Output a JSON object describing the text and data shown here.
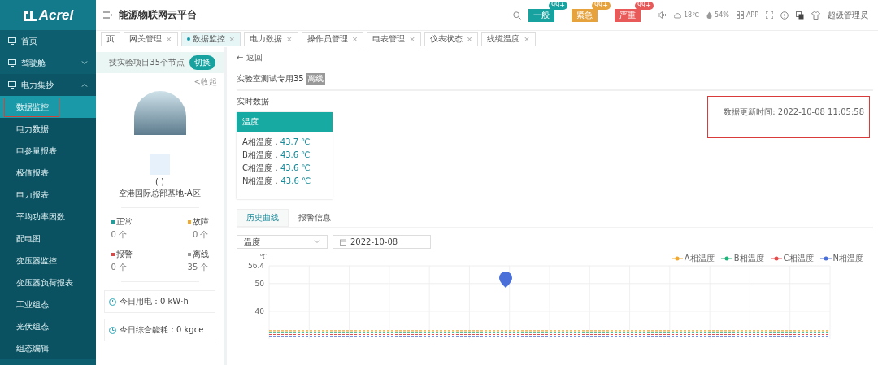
{
  "logo": {
    "text": "Acrel"
  },
  "header": {
    "title": "能源物联网云平台",
    "alarms": [
      {
        "label": "一般",
        "count": "99+",
        "color": "#17a2a0"
      },
      {
        "label": "紧急",
        "count": "99+",
        "color": "#e6a23c"
      },
      {
        "label": "严重",
        "count": "99+",
        "color": "#e8595a"
      }
    ],
    "temperature": "18℃",
    "humidity": "54%",
    "app": "APP",
    "user": "超级管理员"
  },
  "tabs": [
    {
      "label": "页",
      "selected": false
    },
    {
      "label": "网关管理",
      "selected": false,
      "close": "×"
    },
    {
      "label": "数据监控",
      "selected": true,
      "close": "×"
    },
    {
      "label": "电力数据",
      "selected": false,
      "close": "×"
    },
    {
      "label": "操作员管理",
      "selected": false,
      "close": "×"
    },
    {
      "label": "电表管理",
      "selected": false,
      "close": "×"
    },
    {
      "label": "仪表状态",
      "selected": false,
      "close": "×"
    },
    {
      "label": "线缆温度",
      "selected": false,
      "close": "×"
    }
  ],
  "sidebar": {
    "items": [
      {
        "label": "首页"
      },
      {
        "label": "驾驶舱",
        "expanded": false
      },
      {
        "label": "电力集抄",
        "expanded": true,
        "children": [
          {
            "label": "数据监控",
            "selected": true
          },
          {
            "label": "电力数据",
            "selected": false
          },
          {
            "label": "电参量报表",
            "selected": false
          },
          {
            "label": "极值报表",
            "selected": false
          },
          {
            "label": "电力报表",
            "selected": false
          },
          {
            "label": "平均功率因数",
            "selected": false
          },
          {
            "label": "配电图",
            "selected": false
          },
          {
            "label": "变压器监控",
            "selected": false
          },
          {
            "label": "变压器负荷报表",
            "selected": false
          },
          {
            "label": "工业组态",
            "selected": false
          },
          {
            "label": "光伏组态",
            "selected": false
          },
          {
            "label": "组态编辑",
            "selected": false
          }
        ]
      }
    ]
  },
  "project_panel": {
    "project": "技实验项目35个节点",
    "switch": "切换",
    "collapse": "<收起",
    "placeholder_text": "( )",
    "site": "空港国际总部基地-A区",
    "stats": [
      {
        "label": "正常",
        "count": "0 个",
        "color": "#17a2a0"
      },
      {
        "label": "故障",
        "count": "0 个",
        "color": "#f0a830"
      },
      {
        "label": "报警",
        "count": "0 个",
        "color": "#e04848"
      },
      {
        "label": "离线",
        "count": "35 个",
        "color": "#999999"
      }
    ],
    "summaries": [
      "今日用电：0 kW·h",
      "今日综合能耗：0 kgce"
    ]
  },
  "main": {
    "back": "← 返回",
    "device": "实验室测试专用35",
    "device_status": "离线",
    "realtime_title": "实时数据",
    "update_time": "数据更新时间: 2022-10-08 11:05:58",
    "card": {
      "title": "温度",
      "rows": [
        {
          "label": "A相温度：",
          "value": "43.7 ℃"
        },
        {
          "label": "B相温度：",
          "value": "43.6 ℃"
        },
        {
          "label": "C相温度：",
          "value": "43.6 ℃"
        },
        {
          "label": "N相温度：",
          "value": "43.6 ℃"
        }
      ]
    },
    "subtabs": [
      {
        "label": "历史曲线",
        "selected": true
      },
      {
        "label": "报警信息",
        "selected": false
      }
    ],
    "metric_select": "温度",
    "date": "2022-10-08",
    "chart_data": {
      "type": "line",
      "ylabel": "℃",
      "ylim": [
        30,
        56.4
      ],
      "yticks": [
        40,
        50,
        56.4
      ],
      "grid": true,
      "legend": true,
      "series": [
        {
          "name": "A相温度",
          "color": "#f0a830",
          "line_style": "dashed",
          "values": [
            33,
            33,
            33,
            33,
            33,
            33,
            33,
            33,
            33,
            33,
            33,
            33,
            33,
            33,
            33,
            33,
            33,
            33,
            33,
            33,
            33,
            33,
            33,
            33
          ]
        },
        {
          "name": "B相温度",
          "color": "#20b27a",
          "line_style": "dashed",
          "values": [
            32.3,
            32.3,
            32.3,
            32.3,
            32.3,
            32.3,
            32.3,
            32.3,
            32.3,
            32.3,
            32.3,
            32.3,
            32.3,
            32.3,
            32.3,
            32.3,
            32.3,
            32.3,
            32.3,
            32.3,
            32.3,
            32.3,
            32.3,
            32.3
          ]
        },
        {
          "name": "C相温度",
          "color": "#e84a4a",
          "line_style": "dashed",
          "values": [
            31.6,
            31.6,
            31.6,
            31.6,
            31.6,
            31.6,
            31.6,
            31.6,
            31.6,
            31.6,
            31.6,
            31.6,
            31.6,
            31.6,
            31.6,
            31.6,
            31.6,
            31.6,
            31.6,
            31.6,
            31.6,
            31.6,
            31.6,
            31.6
          ]
        },
        {
          "name": "N相温度",
          "color": "#4a6fd8",
          "line_style": "dashed",
          "values": [
            30.9,
            30.9,
            30.9,
            30.9,
            30.9,
            30.9,
            30.9,
            30.9,
            30.9,
            30.9,
            30.9,
            30.9,
            30.9,
            30.9,
            30.9,
            30.9,
            30.9,
            30.9,
            30.9,
            30.9,
            30.9,
            30.9,
            30.9,
            30.9
          ]
        }
      ]
    }
  }
}
